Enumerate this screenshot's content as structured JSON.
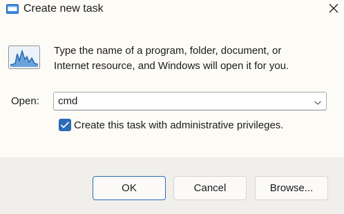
{
  "window": {
    "title": "Create new task",
    "icon": "run-dialog-icon",
    "close_icon": "close-icon"
  },
  "content": {
    "icon": "task-manager-performance-icon",
    "description_line1": "Type the name of a program, folder, document, or",
    "description_line2": "Internet resource, and Windows will open it for you."
  },
  "open_field": {
    "label": "Open:",
    "value": "cmd"
  },
  "admin_checkbox": {
    "label": "Create this task with administrative privileges.",
    "checked": true
  },
  "buttons": {
    "ok": "OK",
    "cancel": "Cancel",
    "browse": "Browse..."
  },
  "colors": {
    "accent": "#2a6cb8",
    "background": "#fdfbf6",
    "footer": "#f1efeb"
  }
}
